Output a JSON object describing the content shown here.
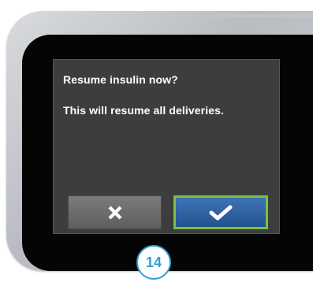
{
  "dialog": {
    "title": "Resume insulin now?",
    "message": "This will resume all deliveries.",
    "cancel_icon": "close-icon",
    "confirm_icon": "checkmark-icon"
  },
  "step_badge": {
    "number": "14"
  },
  "colors": {
    "screen_background": "#3d3d3d",
    "confirm_border": "#7ac043",
    "confirm_fill": "#2f5f9f",
    "cancel_fill": "#6b6b6b",
    "badge_accent": "#2f9fd9"
  }
}
